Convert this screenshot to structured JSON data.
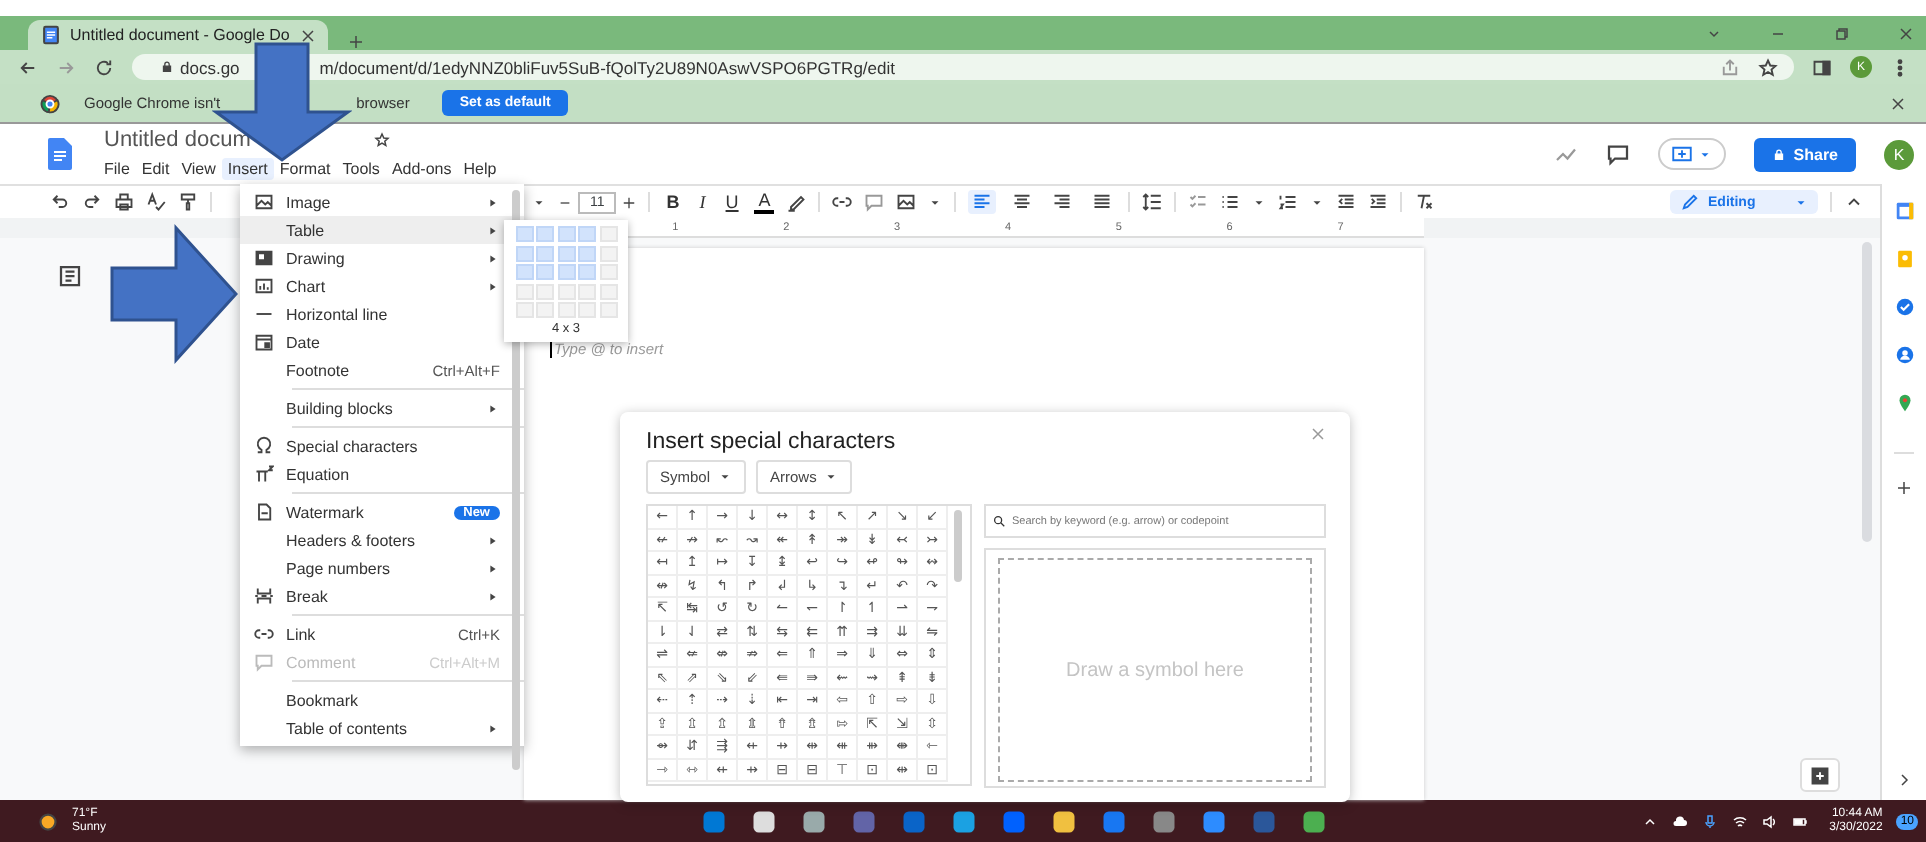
{
  "browser": {
    "tab_title": "Untitled document - Google Do",
    "url_start": "docs.go",
    "url_end": "m/document/d/1edyNNZ0bliFuv5SuB-fQolTy2U89N0AswVSPO6PGTRg/edit",
    "profile": "K"
  },
  "banner": {
    "text_start": "Google Chrome isn't",
    "text_end": "browser",
    "button": "Set as default"
  },
  "docs": {
    "title": "Untitled docum",
    "menus": [
      {
        "label": "File",
        "selected": false
      },
      {
        "label": "Edit",
        "selected": false
      },
      {
        "label": "View",
        "selected": false
      },
      {
        "label": "Insert",
        "selected": true
      },
      {
        "label": "Format",
        "selected": false
      },
      {
        "label": "Tools",
        "selected": false
      },
      {
        "label": "Add-ons",
        "selected": false
      },
      {
        "label": "Help",
        "selected": false
      }
    ],
    "share": "Share",
    "avatar": "K"
  },
  "toolbar": {
    "font_size": "11",
    "format_buttons": [
      "B",
      "I",
      "U",
      "A"
    ],
    "alignments": [
      {
        "selected": true
      },
      {
        "selected": false
      },
      {
        "selected": false
      },
      {
        "selected": false
      }
    ],
    "mode": "Editing"
  },
  "ruler": [
    "1",
    "2",
    "3",
    "4",
    "5",
    "6",
    "7"
  ],
  "document": {
    "placeholder": "Type @ to insert"
  },
  "insert_menu": [
    [
      {
        "label": "Image",
        "submenu": true,
        "selected": false,
        "disabled": false
      },
      {
        "label": "Table",
        "submenu": true,
        "selected": true,
        "disabled": false
      },
      {
        "label": "Drawing",
        "submenu": true,
        "selected": false,
        "disabled": false
      },
      {
        "label": "Chart",
        "submenu": true,
        "selected": false,
        "disabled": false
      },
      {
        "label": "Horizontal line",
        "submenu": false,
        "selected": false,
        "disabled": false
      },
      {
        "label": "Date",
        "submenu": false,
        "selected": false,
        "disabled": false
      },
      {
        "label": "Footnote",
        "shortcut": "Ctrl+Alt+F",
        "submenu": false,
        "selected": false,
        "disabled": false
      }
    ],
    [
      {
        "label": "Building blocks",
        "submenu": true,
        "selected": false,
        "disabled": false
      }
    ],
    [
      {
        "label": "Special characters",
        "submenu": false,
        "selected": false,
        "disabled": false
      },
      {
        "label": "Equation",
        "submenu": false,
        "selected": false,
        "disabled": false
      }
    ],
    [
      {
        "label": "Watermark",
        "badge": "New",
        "submenu": false,
        "selected": false,
        "disabled": false
      },
      {
        "label": "Headers & footers",
        "submenu": true,
        "selected": false,
        "disabled": false
      },
      {
        "label": "Page numbers",
        "submenu": true,
        "selected": false,
        "disabled": false
      },
      {
        "label": "Break",
        "submenu": true,
        "selected": false,
        "disabled": false
      }
    ],
    [
      {
        "label": "Link",
        "shortcut": "Ctrl+K",
        "submenu": false,
        "selected": false,
        "disabled": false
      },
      {
        "label": "Comment",
        "shortcut": "Ctrl+Alt+M",
        "submenu": false,
        "selected": false,
        "disabled": true
      }
    ],
    [
      {
        "label": "Bookmark",
        "submenu": false,
        "selected": false,
        "disabled": false
      },
      {
        "label": "Table of contents",
        "submenu": true,
        "selected": false,
        "disabled": false
      }
    ]
  ],
  "table_picker": {
    "rows": [
      [
        {
          "selected": true
        },
        {
          "selected": true
        },
        {
          "selected": true
        },
        {
          "selected": true
        },
        {
          "selected": false
        }
      ],
      [
        {
          "selected": true
        },
        {
          "selected": true
        },
        {
          "selected": true
        },
        {
          "selected": true
        },
        {
          "selected": false
        }
      ],
      [
        {
          "selected": true
        },
        {
          "selected": true
        },
        {
          "selected": true
        },
        {
          "selected": true
        },
        {
          "selected": false
        }
      ],
      [
        {
          "selected": false
        },
        {
          "selected": false
        },
        {
          "selected": false
        },
        {
          "selected": false
        },
        {
          "selected": false
        }
      ],
      [
        {
          "selected": false
        },
        {
          "selected": false
        },
        {
          "selected": false
        },
        {
          "selected": false
        },
        {
          "selected": false
        }
      ]
    ],
    "label": "4 x 3"
  },
  "special_characters": {
    "title": "Insert special characters",
    "category": "Symbol",
    "subcategory": "Arrows",
    "symbols": [
      [
        "←",
        "↑",
        "→",
        "↓",
        "↔",
        "↕",
        "↖",
        "↗",
        "↘",
        "↙"
      ],
      [
        "↚",
        "↛",
        "↜",
        "↝",
        "↞",
        "↟",
        "↠",
        "↡",
        "↢",
        "↣"
      ],
      [
        "↤",
        "↥",
        "↦",
        "↧",
        "↨",
        "↩",
        "↪",
        "↫",
        "↬",
        "↭"
      ],
      [
        "↮",
        "↯",
        "↰",
        "↱",
        "↲",
        "↳",
        "↴",
        "↵",
        "↶",
        "↷"
      ],
      [
        "↸",
        "↹",
        "↺",
        "↻",
        "↼",
        "↽",
        "↾",
        "↿",
        "⇀",
        "⇁"
      ],
      [
        "⇂",
        "⇃",
        "⇄",
        "⇅",
        "⇆",
        "⇇",
        "⇈",
        "⇉",
        "⇊",
        "⇋"
      ],
      [
        "⇌",
        "⇍",
        "⇎",
        "⇏",
        "⇐",
        "⇑",
        "⇒",
        "⇓",
        "⇔",
        "⇕"
      ],
      [
        "⇖",
        "⇗",
        "⇘",
        "⇙",
        "⇚",
        "⇛",
        "⇜",
        "⇝",
        "⇞",
        "⇟"
      ],
      [
        "⇠",
        "⇡",
        "⇢",
        "⇣",
        "⇤",
        "⇥",
        "⇦",
        "⇧",
        "⇨",
        "⇩"
      ],
      [
        "⇪",
        "⇫",
        "⇬",
        "⇭",
        "⇮",
        "⇯",
        "⇰",
        "⇱",
        "⇲",
        "⇳"
      ],
      [
        "⇴",
        "⇵",
        "⇶",
        "⇷",
        "⇸",
        "⇹",
        "⇺",
        "⇻",
        "⇼",
        "⇽"
      ],
      [
        "⇾",
        "⇿",
        "⇷",
        "⇸",
        "⊟",
        "⊟",
        "⊤",
        "⊡",
        "⇹",
        "⊡"
      ]
    ],
    "search_placeholder": "Search by keyword (e.g. arrow) or codepoint",
    "draw_hint": "Draw a symbol here"
  },
  "taskbar": {
    "temperature": "71°F",
    "condition": "Sunny",
    "time": "10:44 AM",
    "date": "3/30/2022",
    "notifications": "10"
  }
}
